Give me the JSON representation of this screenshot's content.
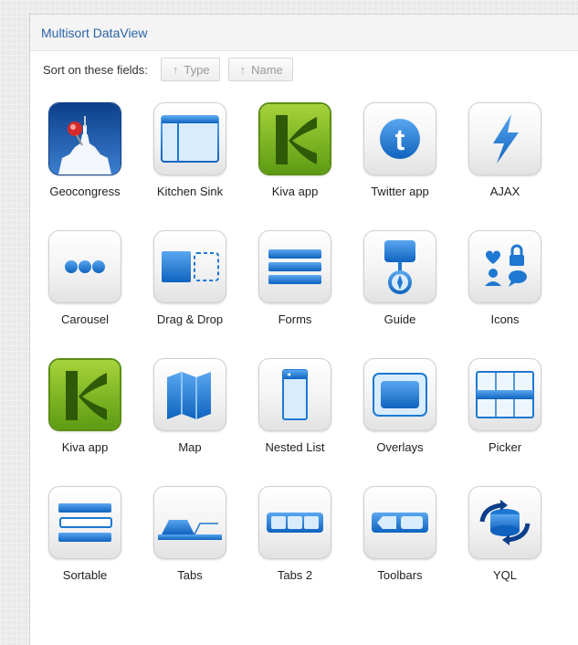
{
  "panel": {
    "title": "Multisort DataView"
  },
  "toolbar": {
    "label": "Sort on these fields:",
    "buttons": [
      "Type",
      "Name"
    ]
  },
  "items": [
    {
      "label": "Geocongress",
      "icon": "capitol-map-pin-icon"
    },
    {
      "label": "Kitchen Sink",
      "icon": "window-icon"
    },
    {
      "label": "Kiva app",
      "icon": "kiva-logo-icon"
    },
    {
      "label": "Twitter app",
      "icon": "twitter-icon"
    },
    {
      "label": "AJAX",
      "icon": "lightning-icon"
    },
    {
      "label": "Carousel",
      "icon": "carousel-dots-icon"
    },
    {
      "label": "Drag & Drop",
      "icon": "drag-drop-icon"
    },
    {
      "label": "Forms",
      "icon": "forms-icon"
    },
    {
      "label": "Guide",
      "icon": "guide-icon"
    },
    {
      "label": "Icons",
      "icon": "icons-icon"
    },
    {
      "label": "Kiva app",
      "icon": "kiva-logo-icon"
    },
    {
      "label": "Map",
      "icon": "map-icon"
    },
    {
      "label": "Nested List",
      "icon": "nested-list-icon"
    },
    {
      "label": "Overlays",
      "icon": "overlays-icon"
    },
    {
      "label": "Picker",
      "icon": "picker-icon"
    },
    {
      "label": "Sortable",
      "icon": "sortable-icon"
    },
    {
      "label": "Tabs",
      "icon": "tabs-icon"
    },
    {
      "label": "Tabs 2",
      "icon": "tabs-2-icon"
    },
    {
      "label": "Toolbars",
      "icon": "toolbars-icon"
    },
    {
      "label": "YQL",
      "icon": "yql-icon"
    }
  ],
  "colors": {
    "accent": "#2a63a8",
    "icon_blue": "#1e78d2",
    "kiva_green": "#7ab317"
  }
}
